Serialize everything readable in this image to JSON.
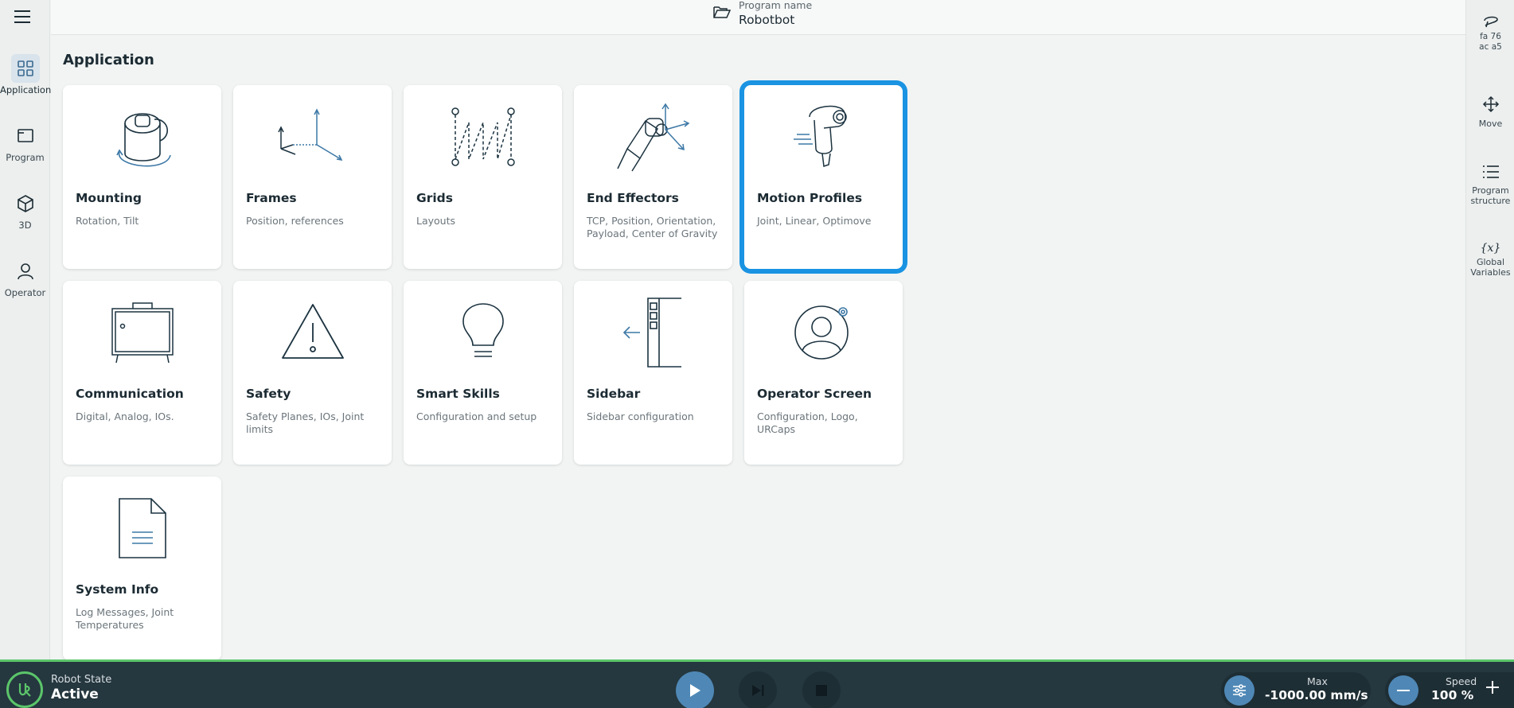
{
  "header": {
    "program_label": "Program name",
    "program_name": "Robotbot"
  },
  "left_nav": {
    "items": [
      {
        "label": "Application",
        "icon": "grid-icon",
        "active": true
      },
      {
        "label": "Program",
        "icon": "program-icon",
        "active": false
      },
      {
        "label": "3D",
        "icon": "cube-icon",
        "active": false
      },
      {
        "label": "Operator",
        "icon": "person-icon",
        "active": false
      }
    ]
  },
  "right_nav": {
    "hex_line1": "fa  76",
    "hex_line2": "ac  a5",
    "items": [
      {
        "label": "Move",
        "icon": "move-arrows-icon"
      },
      {
        "label": "Program structure",
        "icon": "list-icon"
      },
      {
        "label": "Global Variables",
        "icon": "variable-icon"
      }
    ]
  },
  "main": {
    "title": "Application",
    "cards": [
      {
        "title": "Mounting",
        "subtitle": "Rotation, Tilt",
        "icon": "mounting-icon",
        "selected": false
      },
      {
        "title": "Frames",
        "subtitle": "Position, references",
        "icon": "frames-icon",
        "selected": false
      },
      {
        "title": "Grids",
        "subtitle": "Layouts",
        "icon": "grids-icon",
        "selected": false
      },
      {
        "title": "End Effectors",
        "subtitle": "TCP, Position, Orientation, Payload, Center of Gravity",
        "icon": "end-effector-icon",
        "selected": false
      },
      {
        "title": "Motion Profiles",
        "subtitle": "Joint, Linear, Optimove",
        "icon": "motion-profiles-icon",
        "selected": true
      },
      {
        "title": "Communication",
        "subtitle": "Digital, Analog, IOs.",
        "icon": "communication-icon",
        "selected": false
      },
      {
        "title": "Safety",
        "subtitle": "Safety Planes, IOs, Joint limits",
        "icon": "warning-icon",
        "selected": false
      },
      {
        "title": "Smart Skills",
        "subtitle": "Configuration and setup",
        "icon": "lightbulb-icon",
        "selected": false
      },
      {
        "title": "Sidebar",
        "subtitle": "Sidebar configuration",
        "icon": "sidebar-icon",
        "selected": false
      },
      {
        "title": "Operator Screen",
        "subtitle": "Configuration, Logo, URCaps",
        "icon": "operator-screen-icon",
        "selected": false
      },
      {
        "title": "System Info",
        "subtitle": "Log Messages, Joint Temperatures",
        "icon": "document-icon",
        "selected": false
      }
    ]
  },
  "footer": {
    "robot_state_label": "Robot State",
    "robot_state_value": "Active",
    "max_label": "Max",
    "max_value": "-1000.00 mm/s",
    "speed_label": "Speed",
    "speed_value": "100 %"
  },
  "colors": {
    "accent": "#1a93e2",
    "active_green": "#5bc56a",
    "bottom_bar": "#25373f",
    "button_blue": "#4f88b6"
  }
}
